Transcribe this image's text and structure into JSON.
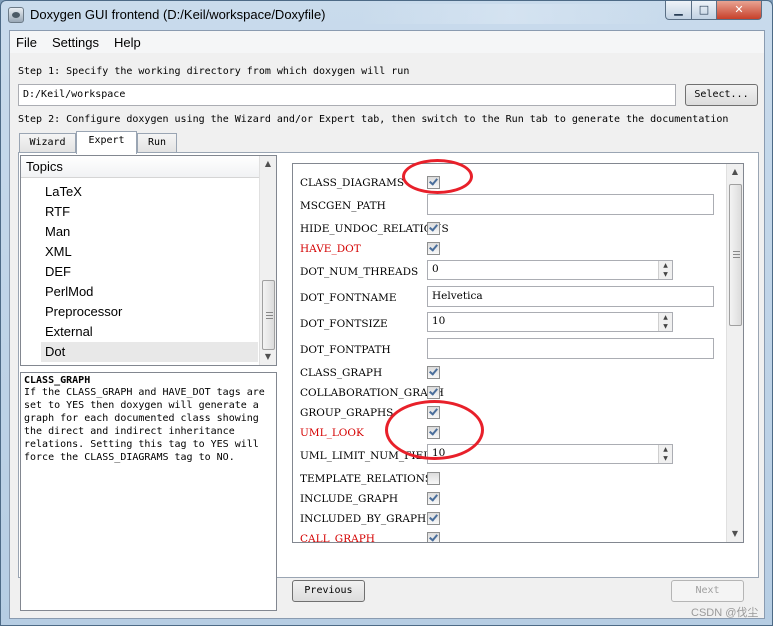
{
  "window": {
    "title": "Doxygen GUI frontend (D:/Keil/workspace/Doxyfile)",
    "buttons": {
      "minimize": "▁",
      "maximize": "□",
      "close": "✕"
    }
  },
  "menu": [
    "File",
    "Settings",
    "Help"
  ],
  "step1": "Step 1: Specify the working directory from which doxygen will run",
  "working_dir": "D:/Keil/workspace",
  "select_button": "Select...",
  "step2": "Step 2: Configure doxygen using the Wizard and/or Expert tab, then switch to the Run tab to generate the documentation",
  "tabs": [
    {
      "label": "Wizard",
      "active": false
    },
    {
      "label": "Expert",
      "active": true
    },
    {
      "label": "Run",
      "active": false
    }
  ],
  "topics": {
    "header": "Topics",
    "items": [
      "LaTeX",
      "RTF",
      "Man",
      "XML",
      "DEF",
      "PerlMod",
      "Preprocessor",
      "External",
      "Dot"
    ],
    "selected": "Dot"
  },
  "help": {
    "title": "CLASS_GRAPH",
    "text": "If the CLASS_GRAPH and HAVE_DOT tags are\nset to YES then doxygen will generate a\ngraph for each documented class showing\nthe direct and indirect inheritance\nrelations. Setting this tag to YES will\nforce the CLASS_DIAGRAMS tag to NO."
  },
  "options": [
    {
      "name": "CLASS_DIAGRAMS",
      "type": "checkbox",
      "checked": true,
      "highlight": false
    },
    {
      "name": "MSCGEN_PATH",
      "type": "text",
      "value": "",
      "highlight": false
    },
    {
      "name": "HIDE_UNDOC_RELATIONS",
      "type": "checkbox",
      "checked": true,
      "highlight": false
    },
    {
      "name": "HAVE_DOT",
      "type": "checkbox",
      "checked": true,
      "highlight": true
    },
    {
      "name": "DOT_NUM_THREADS",
      "type": "spin",
      "value": "0",
      "highlight": false
    },
    {
      "name": "DOT_FONTNAME",
      "type": "text",
      "value": "Helvetica",
      "highlight": false
    },
    {
      "name": "DOT_FONTSIZE",
      "type": "spin",
      "value": "10",
      "highlight": false
    },
    {
      "name": "DOT_FONTPATH",
      "type": "text",
      "value": "",
      "highlight": false
    },
    {
      "name": "CLASS_GRAPH",
      "type": "checkbox",
      "checked": true,
      "highlight": false
    },
    {
      "name": "COLLABORATION_GRAPH",
      "type": "checkbox",
      "checked": true,
      "highlight": false
    },
    {
      "name": "GROUP_GRAPHS",
      "type": "checkbox",
      "checked": true,
      "highlight": false
    },
    {
      "name": "UML_LOOK",
      "type": "checkbox",
      "checked": true,
      "highlight": true
    },
    {
      "name": "UML_LIMIT_NUM_FIELDS",
      "type": "spin",
      "value": "10",
      "highlight": false
    },
    {
      "name": "TEMPLATE_RELATIONS",
      "type": "checkbox",
      "checked": false,
      "highlight": false
    },
    {
      "name": "INCLUDE_GRAPH",
      "type": "checkbox",
      "checked": true,
      "highlight": false
    },
    {
      "name": "INCLUDED_BY_GRAPH",
      "type": "checkbox",
      "checked": true,
      "highlight": false
    },
    {
      "name": "CALL_GRAPH",
      "type": "checkbox",
      "checked": true,
      "highlight": true
    }
  ],
  "previous_button": "Previous",
  "next_button": "Next",
  "watermark": "CSDN @伐尘",
  "colors": {
    "highlight_text": "#d40000",
    "annotation": "#e8202a",
    "check": "#4a6e9b"
  }
}
